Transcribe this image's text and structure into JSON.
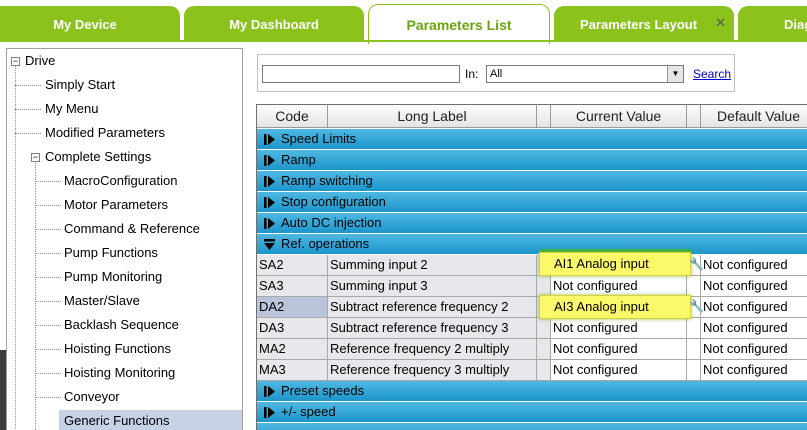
{
  "tabs": [
    {
      "label": "My Device"
    },
    {
      "label": "My Dashboard"
    },
    {
      "label": "Parameters List"
    },
    {
      "label": "Parameters Layout"
    },
    {
      "label": "Diag"
    }
  ],
  "tree": {
    "items": [
      {
        "label": "Drive"
      },
      {
        "label": "Simply Start"
      },
      {
        "label": "My Menu"
      },
      {
        "label": "Modified Parameters"
      },
      {
        "label": "Complete Settings"
      },
      {
        "label": "MacroConfiguration"
      },
      {
        "label": "Motor Parameters"
      },
      {
        "label": "Command & Reference"
      },
      {
        "label": "Pump Functions"
      },
      {
        "label": "Pump Monitoring"
      },
      {
        "label": "Master/Slave"
      },
      {
        "label": "Backlash Sequence"
      },
      {
        "label": "Hoisting Functions"
      },
      {
        "label": "Hoisting Monitoring"
      },
      {
        "label": "Conveyor"
      },
      {
        "label": "Generic Functions"
      }
    ],
    "selected": "Generic Functions"
  },
  "search": {
    "value": "",
    "in_label": "In:",
    "filter_value": "All",
    "button_label": "Search"
  },
  "grid": {
    "columns": [
      "Code",
      "Long Label",
      "Current Value",
      "Default Value"
    ],
    "groups": [
      {
        "label": "Speed Limits"
      },
      {
        "label": "Ramp"
      },
      {
        "label": "Ramp switching"
      },
      {
        "label": "Stop configuration"
      },
      {
        "label": "Auto DC injection"
      },
      {
        "label": "Ref. operations"
      },
      {
        "label": "Preset speeds"
      },
      {
        "label": "+/- speed"
      }
    ],
    "rows": [
      {
        "code": "SA2",
        "label": "Summing input 2",
        "current": "AI1 Analog input",
        "default": "Not configured"
      },
      {
        "code": "SA3",
        "label": "Summing input 3",
        "current": "Not configured",
        "default": "Not configured"
      },
      {
        "code": "DA2",
        "label": "Subtract reference frequency 2",
        "current": "AI3 Analog input",
        "default": "Not configured"
      },
      {
        "code": "DA3",
        "label": "Subtract reference frequency 3",
        "current": "Not configured",
        "default": "Not configured"
      },
      {
        "code": "MA2",
        "label": "Reference frequency 2 multiply",
        "current": "Not configured",
        "default": "Not configured"
      },
      {
        "code": "MA3",
        "label": "Reference frequency 3 multiply",
        "current": "Not configured",
        "default": "Not configured"
      }
    ]
  },
  "colors": {
    "tab_green": "#8bc21c",
    "group_blue": "#1c95cb",
    "highlight_yellow": "#fbf86a"
  }
}
